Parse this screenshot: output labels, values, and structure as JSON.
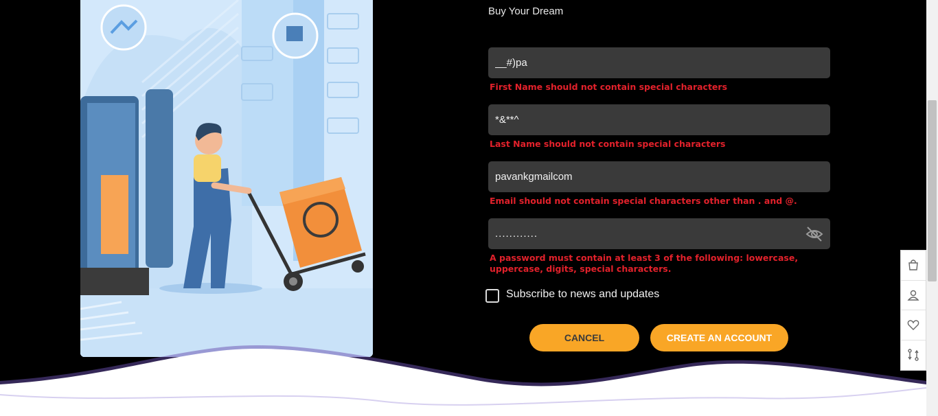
{
  "brand": {
    "tagline": "Buy Your Dream"
  },
  "form": {
    "first_name": {
      "value": "__#)pa",
      "error": "First Name should not contain special characters"
    },
    "last_name": {
      "value": "*&**^",
      "error": "Last Name should not contain special characters"
    },
    "email": {
      "value": "pavankgmailcom",
      "error": "Email should not contain special characters other than . and @."
    },
    "password": {
      "value": "............",
      "error": "A password must contain at least 3 of the following: lowercase, uppercase, digits, special characters."
    },
    "subscribe_label": "Subscribe to news and updates",
    "cancel_label": "CANCEL",
    "create_label": "CREATE AN ACCOUNT"
  },
  "sidebar": {
    "items": [
      {
        "icon": "bag-icon"
      },
      {
        "icon": "user-icon"
      },
      {
        "icon": "heart-icon"
      },
      {
        "icon": "compare-icon"
      }
    ]
  },
  "colors": {
    "accent": "#f9a626",
    "error": "#e2212b",
    "field_bg": "#3a3a3a",
    "page_bg": "#000000"
  }
}
